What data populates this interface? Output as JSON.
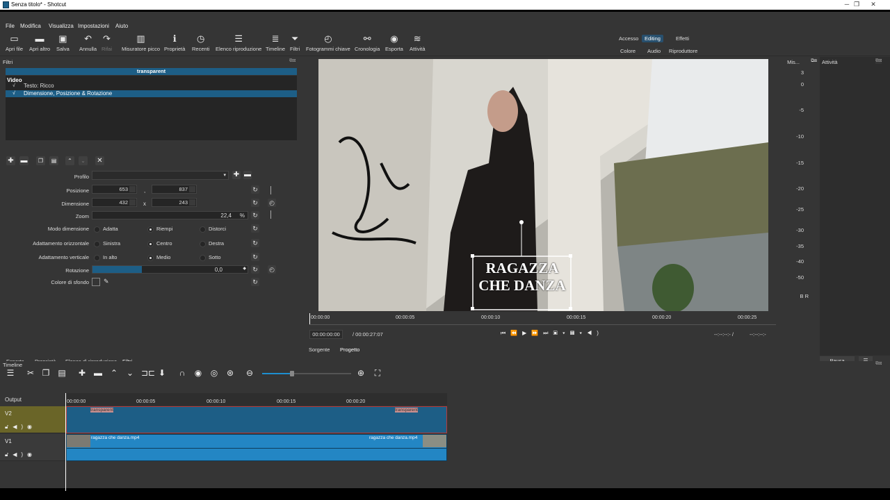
{
  "window": {
    "title": "Senza titolo* - Shotcut",
    "min": "─",
    "max": "❐",
    "close": "✕"
  },
  "menu": [
    "File",
    "Modifica",
    "Visualizza",
    "Impostazioni",
    "Aiuto"
  ],
  "toolbar": [
    {
      "label": "Apri file",
      "icon": "folder-icon",
      "glyph": "▭"
    },
    {
      "label": "Apri altro",
      "icon": "open-other-icon",
      "glyph": "▬"
    },
    {
      "label": "Salva",
      "icon": "save-icon",
      "glyph": "▣"
    },
    {
      "label": "Annulla",
      "icon": "undo-icon",
      "glyph": "↶"
    },
    {
      "label": "Rifai",
      "icon": "redo-icon",
      "glyph": "↷"
    },
    {
      "label": "Misuratore picco",
      "icon": "peak-meter-icon",
      "glyph": "▥"
    },
    {
      "label": "Proprietà",
      "icon": "info-icon",
      "glyph": "ℹ"
    },
    {
      "label": "Recenti",
      "icon": "clock-icon",
      "glyph": "◷"
    },
    {
      "label": "Elenco riproduzione",
      "icon": "list-icon",
      "glyph": "☰"
    },
    {
      "label": "Timeline",
      "icon": "timeline-icon",
      "glyph": "≣"
    },
    {
      "label": "Filtri",
      "icon": "filter-icon",
      "glyph": "⏷"
    },
    {
      "label": "Fotogrammi chiave",
      "icon": "stopwatch-icon",
      "glyph": "◴"
    },
    {
      "label": "Cronologia",
      "icon": "history-icon",
      "glyph": "⚯"
    },
    {
      "label": "Esporta",
      "icon": "export-icon",
      "glyph": "◉"
    },
    {
      "label": "Attività",
      "icon": "jobs-icon",
      "glyph": "≋"
    }
  ],
  "layouts": {
    "accesso": "Accesso",
    "editing": "Editing",
    "effetti": "Effetti",
    "colore": "Colore",
    "audio": "Audio",
    "riproduttore": "Riproduttore"
  },
  "filters_panel": {
    "title": "Filtri",
    "current": "transparent",
    "group": "Video",
    "items": [
      {
        "check": "√",
        "label": "Testo: Ricco"
      },
      {
        "check": "√",
        "label": "Dimensione, Posizione & Rotazione"
      }
    ],
    "profilo_label": "Profilo",
    "posizione_label": "Posizione",
    "pos_x": "653",
    "pos_sep": ",",
    "pos_y": "837",
    "dimensione_label": "Dimensione",
    "dim_w": "432",
    "dim_sep": "x",
    "dim_h": "243",
    "zoom_label": "Zoom",
    "zoom_value": "22,4",
    "zoom_unit": "%",
    "modo_label": "Modo dimensione",
    "modo": [
      "Adatta",
      "Riempi",
      "Distorci"
    ],
    "orizz_label": "Adattamento orizzontale",
    "orizz": [
      "Sinistra",
      "Centro",
      "Destra"
    ],
    "vert_label": "Adattamento verticale",
    "vert": [
      "In alto",
      "Medio",
      "Sotto"
    ],
    "rotazione_label": "Rotazione",
    "rotazione_value": "0,0",
    "rotazione_fraction": 0.32,
    "sfondo_label": "Colore di sfondo"
  },
  "left_tabs": [
    "Esporta",
    "Proprietà",
    "Elenco di riproduzione",
    "Filtri"
  ],
  "viewer": {
    "overlay_line1": "RAGAZZA",
    "overlay_line2": "CHE DANZA",
    "ruler": [
      "00:00:00",
      "00:00:05",
      "00:00:10",
      "00:00:15",
      "00:00:20",
      "00:00:25"
    ],
    "timecode": "00:00:00:00",
    "duration": "/ 00:00:27:07",
    "in_point": "--:--:--:- /",
    "out_point": "--:--:--:-",
    "tabs": [
      "Sorgente",
      "Progetto"
    ]
  },
  "meter": {
    "title": "Mis...",
    "scale": [
      "3",
      "0",
      "-5",
      "-10",
      "-15",
      "-20",
      "-25",
      "-30",
      "-35",
      "-40",
      "-50"
    ],
    "channels": "B  R"
  },
  "activity": {
    "title": "Attività",
    "pause": "Pausa",
    "menu": "☰"
  },
  "timeline": {
    "title": "Timeline",
    "ruler": [
      "00:00:00",
      "00:00:05",
      "00:00:10",
      "00:00:15",
      "00:00:20"
    ],
    "output": "Output",
    "tracks": [
      {
        "name": "V2",
        "clip_start": "transparent",
        "clip_end": "transparent"
      },
      {
        "name": "V1",
        "clip_start": "ragazza che danza.mp4",
        "clip_end": "ragazza che danza.mp4"
      }
    ]
  },
  "colors": {
    "accent": "#1d5e86",
    "bg": "#353535",
    "track_v2": "#6a6528"
  }
}
